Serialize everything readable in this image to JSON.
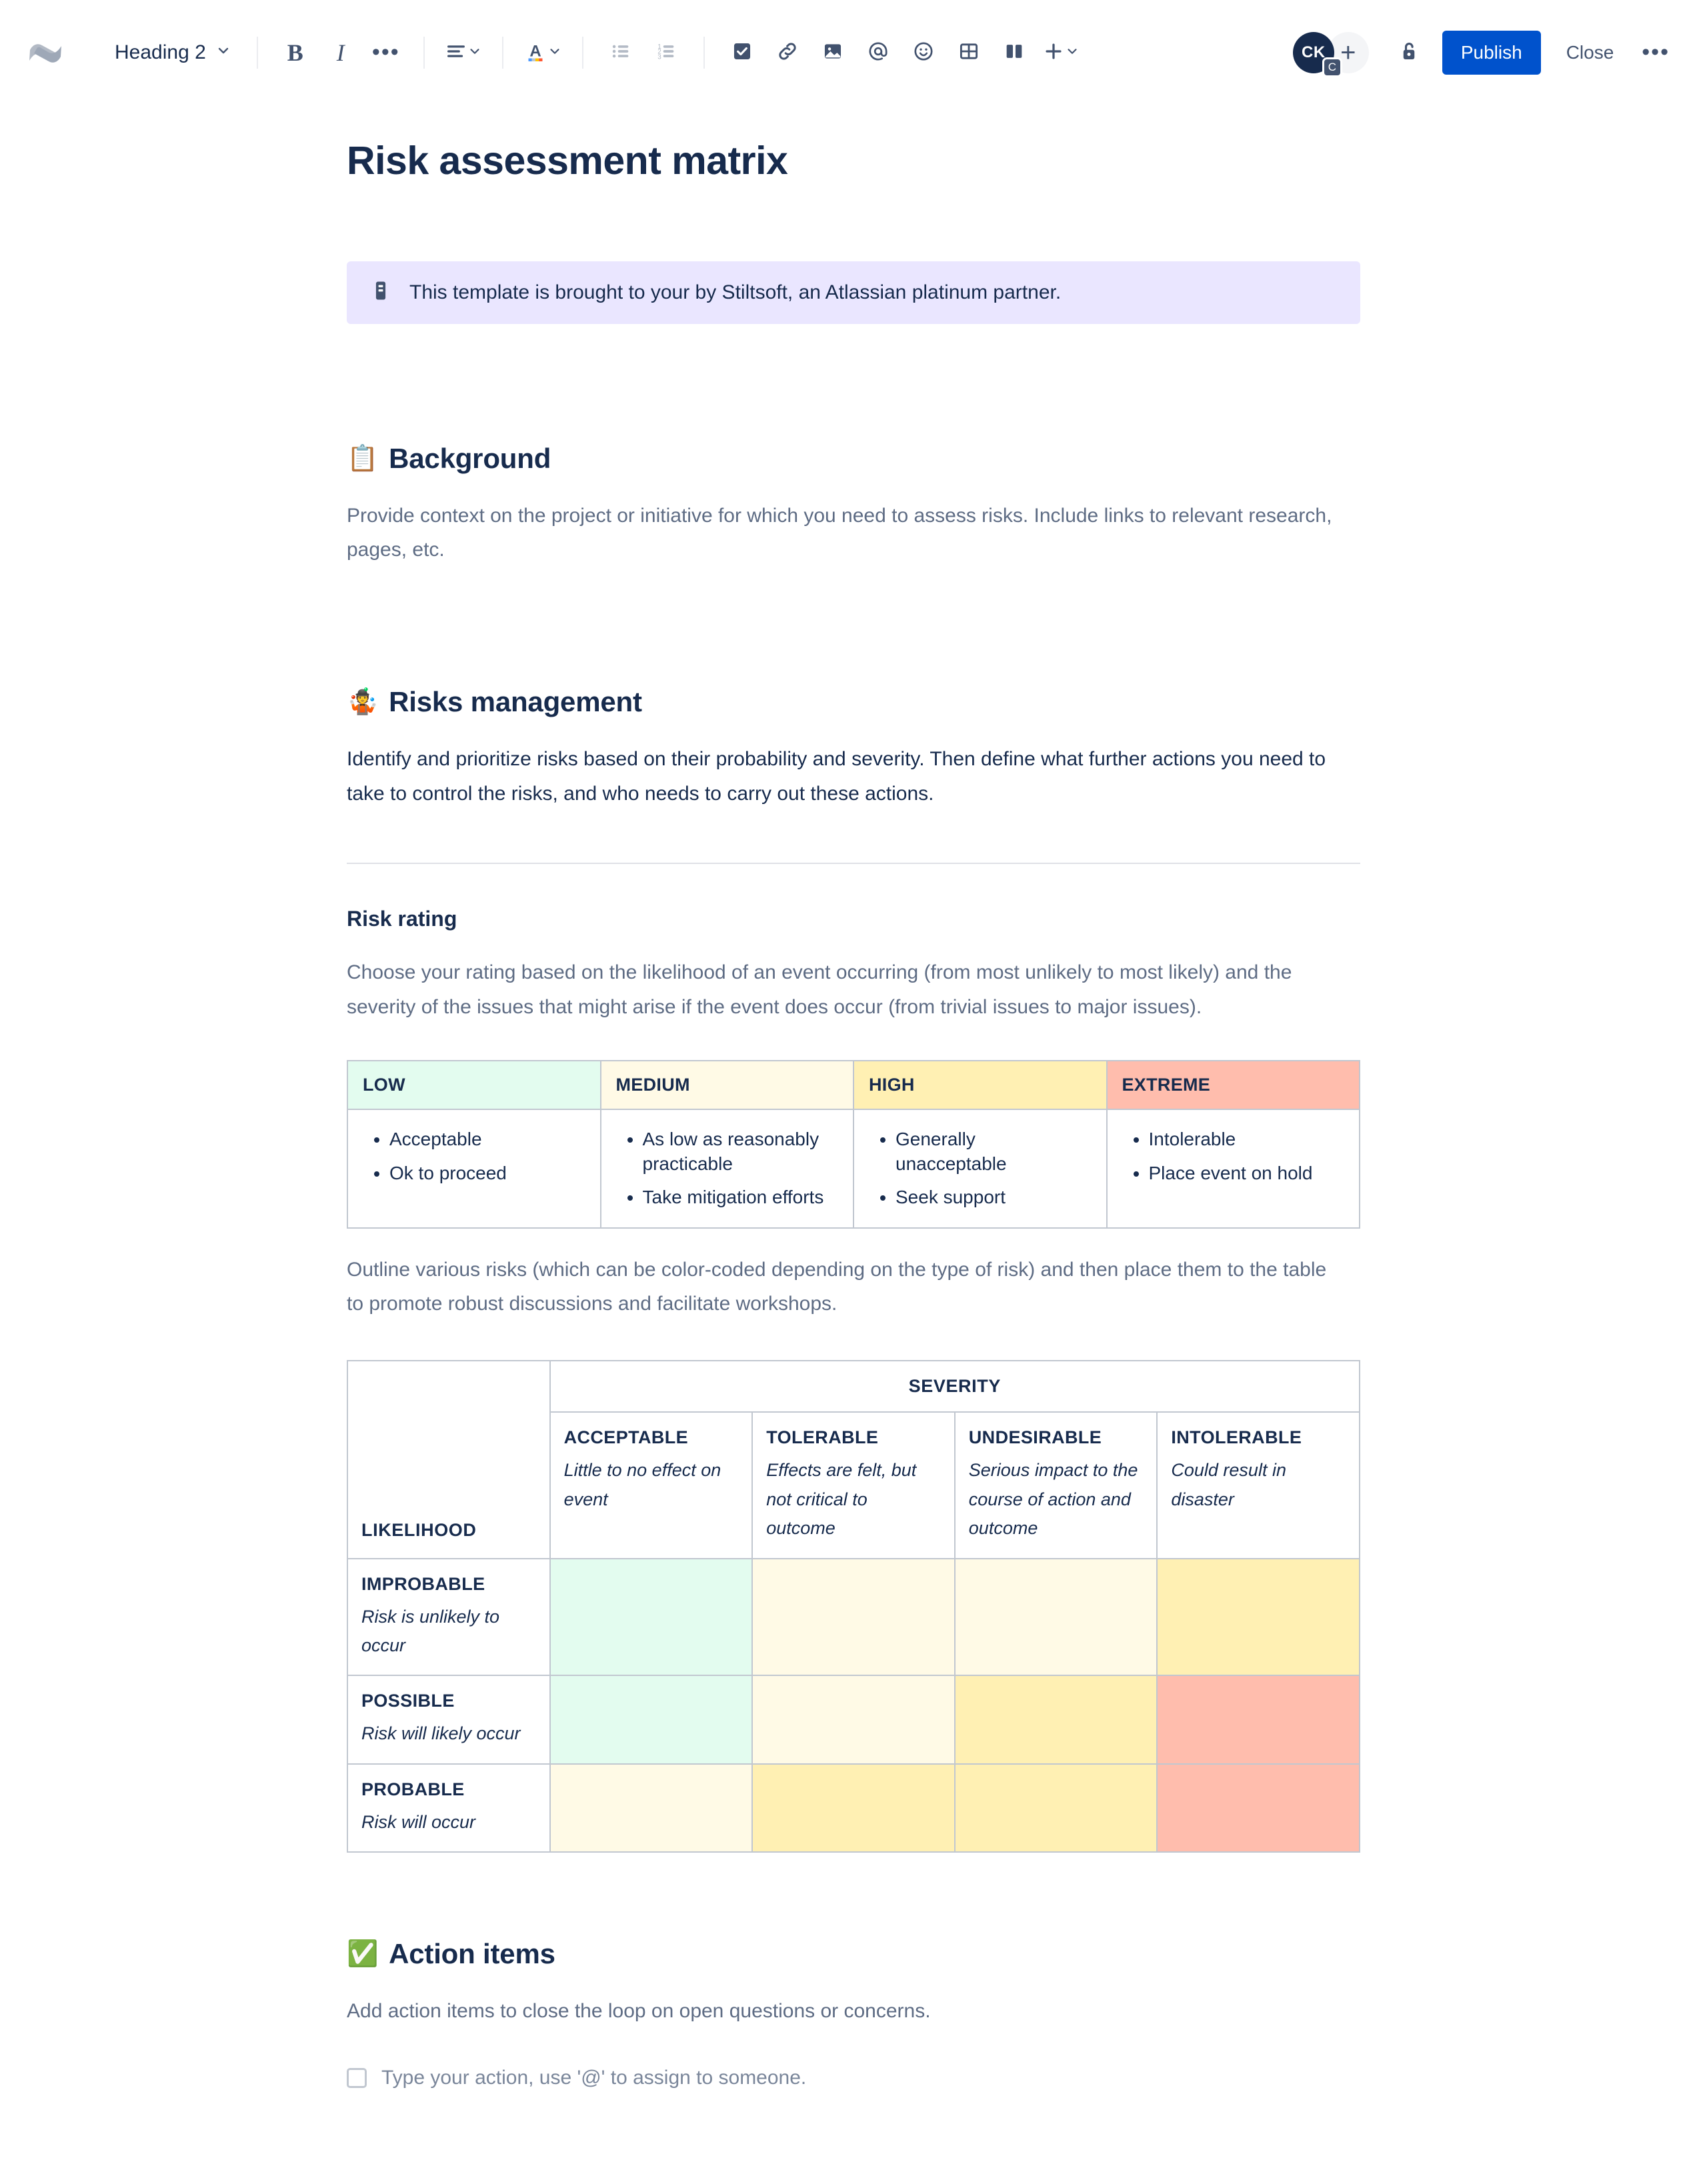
{
  "toolbar": {
    "logo_name": "confluence-logo",
    "style_selector": {
      "label": "Heading 2",
      "icon": "chevron-down-icon"
    },
    "bold_label": "B",
    "italic_label": "I",
    "more_formatting_label": "•••",
    "align_icon": "text-align-left-icon",
    "color_icon": "text-color-icon",
    "bullet_list_icon": "bullet-list-icon",
    "numbered_list_icon": "numbered-list-icon",
    "task_icon": "task-checkbox-icon",
    "link_icon": "link-icon",
    "image_icon": "image-icon",
    "mention_icon": "mention-at-icon",
    "emoji_icon": "emoji-smiley-icon",
    "table_icon": "table-icon",
    "layout_icon": "page-layout-icon",
    "insert_icon": "plus-icon",
    "avatar_initials": "CK",
    "avatar_badge": "C",
    "add_person_label": "+",
    "restrictions_icon": "unlocked-padlock-icon",
    "publish_label": "Publish",
    "close_label": "Close",
    "more_label": "•••"
  },
  "document": {
    "title": "Risk assessment matrix",
    "info_panel": {
      "icon": "page-info-icon",
      "text": "This template is brought to your by Stiltsoft, an Atlassian platinum partner."
    },
    "sections": {
      "background": {
        "emoji": "📋",
        "heading": "Background",
        "paragraph": "Provide context on the project or initiative for which you need to assess risks. Include links to relevant research, pages, etc."
      },
      "risks": {
        "emoji": "🤹",
        "heading": "Risks management",
        "paragraph": "Identify and prioritize risks based on their probability and severity. Then define what further actions you need to take to control the risks, and who needs to carry out these actions.",
        "subheading": "Risk rating",
        "sub_paragraph": "Choose your rating based on the likelihood of an event occurring (from most unlikely to most likely) and the severity of the issues that might arise if the event does occur (from trivial issues to major issues).",
        "outline_paragraph": "Outline various risks (which can be color-coded depending on the type of risk) and then place them to the table to promote robust discussions and facilitate workshops."
      },
      "action_items": {
        "emoji": "✅",
        "heading": "Action items",
        "paragraph": "Add action items to close the loop on open questions or concerns.",
        "task_placeholder": "Type your action, use '@' to assign to someone."
      }
    }
  },
  "rating_table": {
    "columns": [
      {
        "label": "LOW",
        "header_color": "#e3fcef",
        "items": [
          "Acceptable",
          "Ok to proceed"
        ]
      },
      {
        "label": "MEDIUM",
        "header_color": "#fffae6",
        "items": [
          "As low as reasonably practicable",
          "Take mitigation efforts"
        ]
      },
      {
        "label": "HIGH",
        "header_color": "#fff0b3",
        "items": [
          "Generally unacceptable",
          "Seek support"
        ]
      },
      {
        "label": "EXTREME",
        "header_color": "#ffbdad",
        "items": [
          "Intolerable",
          "Place event on hold"
        ]
      }
    ]
  },
  "matrix_table": {
    "severity_label": "SEVERITY",
    "likelihood_label": "LIKELIHOOD",
    "severity_columns": [
      {
        "title": "ACCEPTABLE",
        "desc": "Little to no effect on event"
      },
      {
        "title": "TOLERABLE",
        "desc": "Effects are felt, but not critical to outcome"
      },
      {
        "title": "UNDESIRABLE",
        "desc": "Serious impact to the course of action and outcome"
      },
      {
        "title": "INTOLERABLE",
        "desc": "Could result in disaster"
      }
    ],
    "likelihood_rows": [
      {
        "title": "IMPROBABLE",
        "desc": "Risk is unlikely to occur",
        "cell_colors": [
          "#e3fcef",
          "#fffae6",
          "#fffae6",
          "#fff0b3"
        ]
      },
      {
        "title": "POSSIBLE",
        "desc": "Risk will likely occur",
        "cell_colors": [
          "#e3fcef",
          "#fffae6",
          "#fff0b3",
          "#ffbdad"
        ]
      },
      {
        "title": "PROBABLE",
        "desc": "Risk will occur",
        "cell_colors": [
          "#fffae6",
          "#fff0b3",
          "#fff0b3",
          "#ffbdad"
        ]
      }
    ]
  },
  "colors": {
    "brand_blue": "#0052cc",
    "text_dark": "#172b4d",
    "text_muted": "#5e6c84",
    "panel_purple": "#eae6ff",
    "border": "#c1c7d0",
    "green": "#e3fcef",
    "cream": "#fffae6",
    "yellow": "#fff0b3",
    "red": "#ffbdad"
  }
}
